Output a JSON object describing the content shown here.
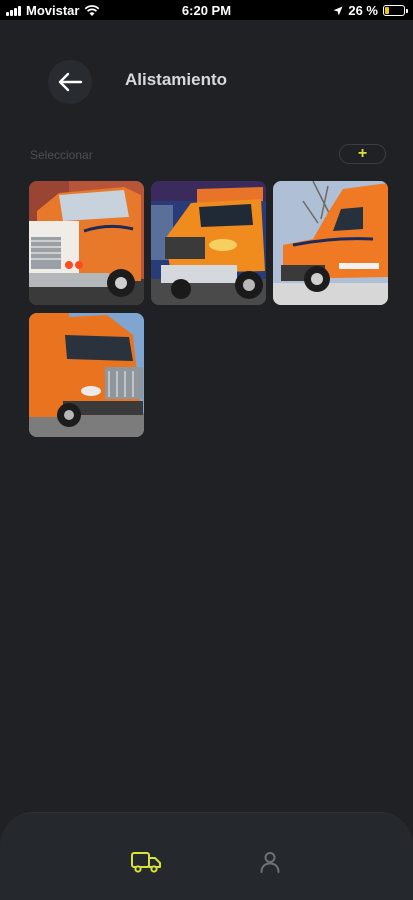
{
  "status_bar": {
    "carrier": "Movistar",
    "time": "6:20 PM",
    "battery_text": "26 %",
    "battery_level": 0.26,
    "battery_color": "#f0c419"
  },
  "header": {
    "title": "Alistamiento",
    "back_icon": "arrow-left-icon"
  },
  "section": {
    "label": "Seleccionar",
    "add_label": "+",
    "accent": "#d8e23a"
  },
  "vehicles": [
    {
      "name": "truck-photo-1",
      "truck_color": "#e8782a"
    },
    {
      "name": "truck-photo-2",
      "truck_color": "#f08c1e"
    },
    {
      "name": "truck-photo-3",
      "truck_color": "#ef7a23"
    },
    {
      "name": "truck-photo-4",
      "truck_color": "#e9731f"
    }
  ],
  "bottom_nav": {
    "items": [
      {
        "icon": "truck-icon",
        "active": true,
        "color": "#d8e23a"
      },
      {
        "icon": "user-icon",
        "active": false,
        "color": "#6d7177"
      }
    ]
  }
}
